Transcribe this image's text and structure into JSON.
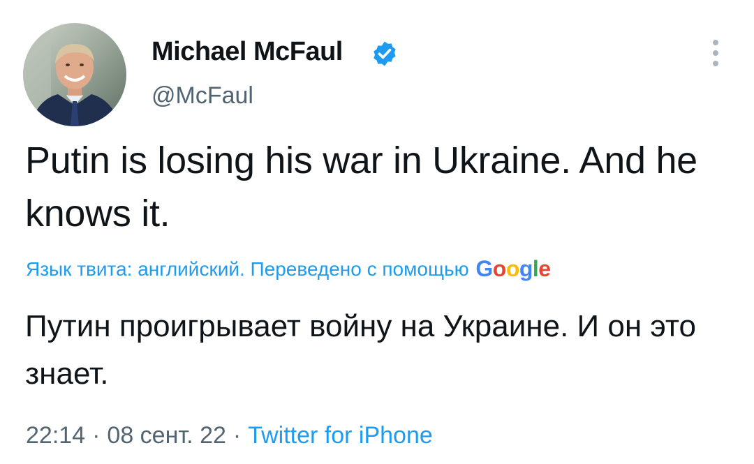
{
  "author": {
    "name": "Michael McFaul",
    "handle": "@McFaul",
    "verified": true
  },
  "tweet": {
    "text": "Putin is losing his war in Ukraine. And he knows it.",
    "translation_label": "Язык твита: английский. Переведено с помощью",
    "translation_provider": "Google",
    "translated_text": "Путин проигрывает войну на Украине. И он это знает.",
    "time": "22:14",
    "date": "08 сент. 22",
    "separator": "·",
    "source": "Twitter for iPhone"
  },
  "icons": {
    "verified": "verified-badge-icon",
    "more": "more-vertical-icon"
  },
  "colors": {
    "text": "#0f1419",
    "secondary": "#536471",
    "accent": "#1d9bf0",
    "google_blue": "#4285f4",
    "google_red": "#ea4335",
    "google_yellow": "#fbbc05",
    "google_green": "#34a853"
  }
}
